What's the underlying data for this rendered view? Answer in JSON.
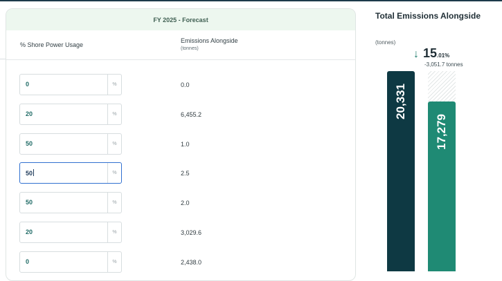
{
  "panel": {
    "header": "FY 2025 - Forecast",
    "col_pct_header": "% Shore Power Usage",
    "col_em_header": "Emissions Alongside",
    "col_em_unit": "(tonnes)",
    "pct_suffix": "%",
    "rows": [
      {
        "pct": "0",
        "emissions": "0.0"
      },
      {
        "pct": "20",
        "emissions": "6,455.2"
      },
      {
        "pct": "50",
        "emissions": "1.0"
      },
      {
        "pct": "50",
        "emissions": "2.5"
      },
      {
        "pct": "50",
        "emissions": "2.0"
      },
      {
        "pct": "20",
        "emissions": "3,029.6"
      },
      {
        "pct": "0",
        "emissions": "2,438.0"
      }
    ],
    "focused_row": 3
  },
  "summary": {
    "title": "Total Emissions Alongside",
    "unit": "(tonnes)",
    "delta_arrow": "↓",
    "delta_int": "15",
    "delta_dec": ".01%",
    "delta_tonnes": "-3,051.7 tonnes",
    "baseline_label": "20,331",
    "forecast_label": "17,279"
  },
  "chart_data": {
    "type": "bar",
    "categories": [
      "",
      ""
    ],
    "values": [
      20331,
      17279
    ],
    "title": "Total Emissions Alongside",
    "ylabel": "(tonnes)",
    "colors": [
      "#0e3943",
      "#1f8a74"
    ]
  }
}
